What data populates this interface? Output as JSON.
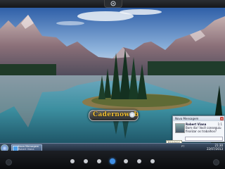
{
  "colors": {
    "sky_top": "#2f5fa8",
    "lake": "#3c8fa0",
    "taskbar": "#2d3c52",
    "active_dot": "#3f8fe6",
    "logo_text": "#f2c033"
  },
  "top_handle": {
    "icon": "app-launcher-icon"
  },
  "logo": {
    "text": "Cadernoweb"
  },
  "notification": {
    "header": "Nova Mensagem",
    "close_symbol": "×",
    "sender": "Robert Viana",
    "message": "Bom dia! Você conseguiu finalizar os trabalhos?",
    "count": "1:1"
  },
  "tooltip": "Imagens",
  "taskbar": {
    "task_line1": "Nova Mensagem",
    "task_line2": "Robert Viana",
    "tray_text": "PT",
    "time": "21:30",
    "date": "22/07/2013"
  },
  "pager": {
    "count": 7,
    "active_index": 3
  }
}
